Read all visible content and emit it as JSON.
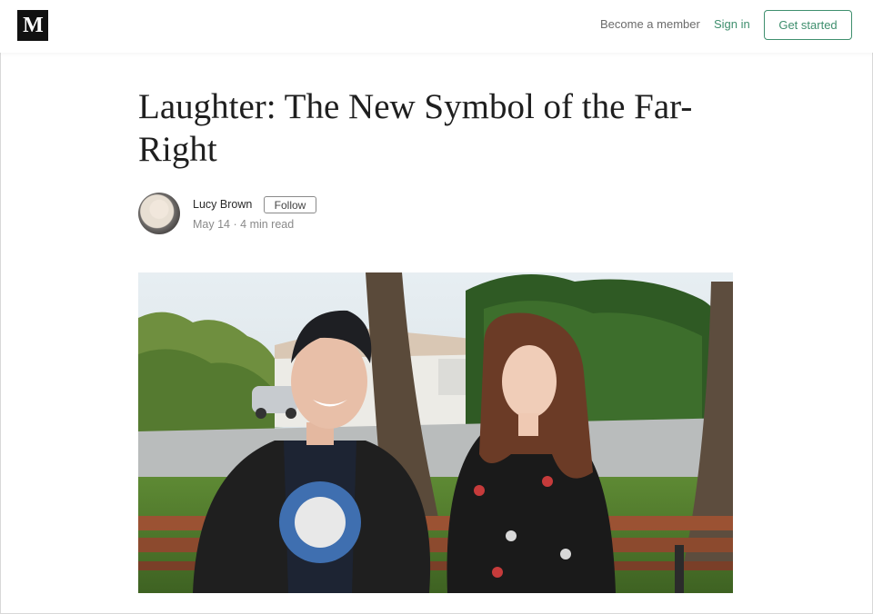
{
  "nav": {
    "logo": "M",
    "become_member": "Become a member",
    "sign_in": "Sign in",
    "get_started": "Get started"
  },
  "article": {
    "title": "Laughter: The New Symbol of the Far-Right",
    "author": "Lucy Brown",
    "follow_label": "Follow",
    "date": "May 14",
    "separator": "·",
    "read_time": "4 min read"
  },
  "colors": {
    "accent": "#3f8f6e",
    "text": "#292929",
    "muted": "#8a8a8a"
  }
}
